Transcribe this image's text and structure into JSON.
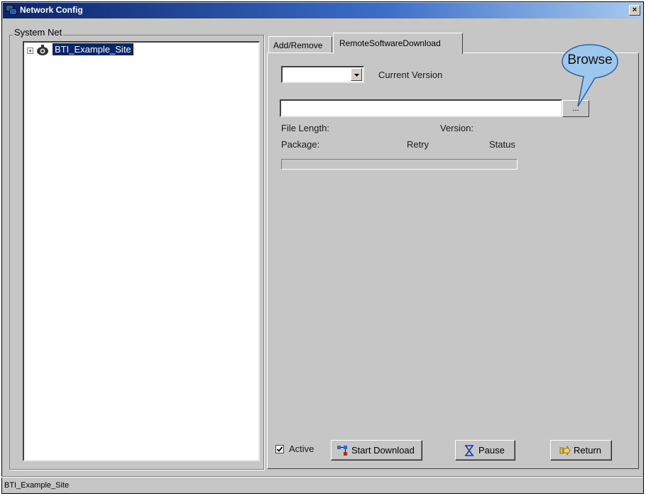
{
  "window": {
    "title": "Network Config",
    "close_label": "×"
  },
  "tree": {
    "group_label": "System Net",
    "expander": "+",
    "node_label": "BTI_Example_Site"
  },
  "tabs": [
    {
      "label": "Add/Remove",
      "active": false
    },
    {
      "label": "RemoteSoftwareDownload",
      "active": true
    }
  ],
  "remote": {
    "version_select_value": "",
    "current_version_label": "Current Version",
    "file_path_value": "",
    "browse_button_label": "...",
    "callout_label": "Browse",
    "file_length_label": "File Length:",
    "version_label": "Version:",
    "package_label": "Package:",
    "retry_label": "Retry",
    "status_label": "Status",
    "progress": 0
  },
  "footer": {
    "active_label": "Active",
    "active_checked": true,
    "start_download_label": "Start Download",
    "pause_label": "Pause",
    "return_label": "Return"
  },
  "status_bar": {
    "text": "BTI_Example_Site"
  },
  "colors": {
    "window_bg": "#c6c6c6",
    "title_bar": "#0a246a",
    "selection": "#0a246a",
    "callout_fill": "#9cc8f0"
  }
}
